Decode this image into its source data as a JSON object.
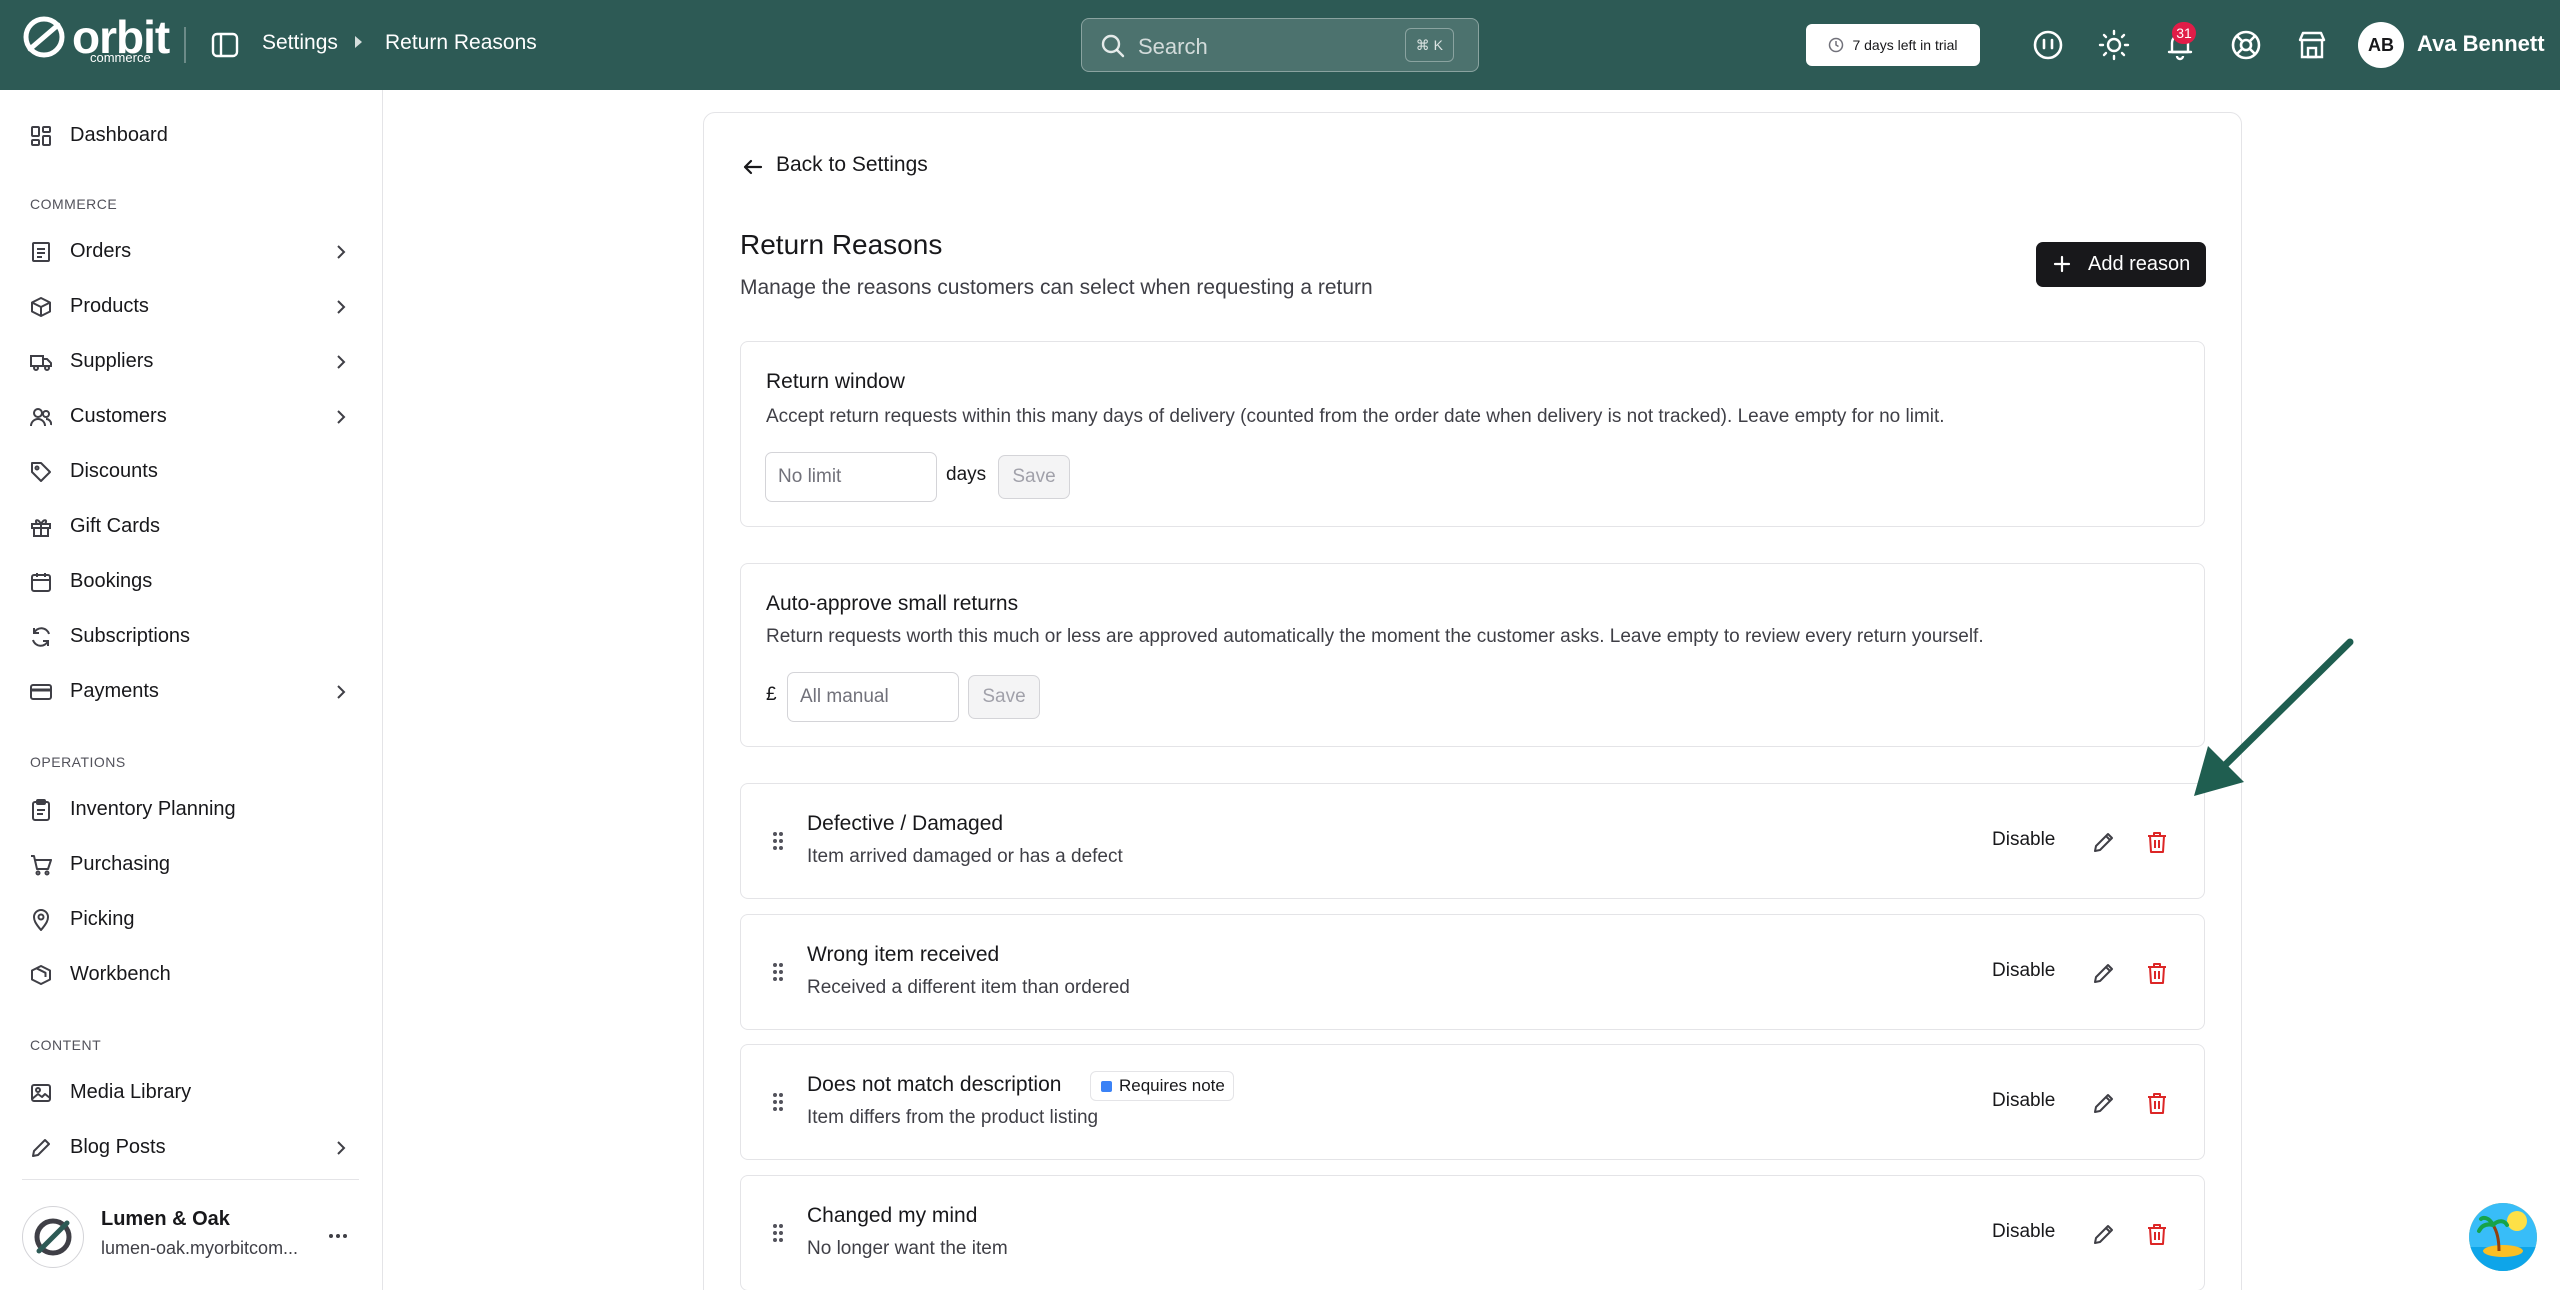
{
  "app": {
    "brand": "orbit",
    "brand_sub": "commerce",
    "colors": {
      "topbar": "#2d5a55",
      "accent": "#1f5e50",
      "danger": "#dc2626",
      "badge": "#e11d48",
      "tag_dot": "#3b82f6"
    }
  },
  "header": {
    "breadcrumb": [
      "Settings",
      "Return Reasons"
    ],
    "search": {
      "placeholder": "Search",
      "shortcut": "⌘ K"
    },
    "trial": "7 days left in trial",
    "notifications_count": "31",
    "user": {
      "initials": "AB",
      "name": "Ava Bennett"
    },
    "icons": [
      "ai-assistant-icon",
      "theme-sun-icon",
      "bell-icon",
      "help-lifebuoy-icon",
      "storefront-icon"
    ]
  },
  "sidebar": {
    "top": [
      {
        "label": "Dashboard",
        "icon": "dashboard-icon"
      }
    ],
    "sections": [
      {
        "label": "COMMERCE",
        "items": [
          {
            "label": "Orders",
            "icon": "orders-icon",
            "chevron": true
          },
          {
            "label": "Products",
            "icon": "box-icon",
            "chevron": true
          },
          {
            "label": "Suppliers",
            "icon": "truck-icon",
            "chevron": true
          },
          {
            "label": "Customers",
            "icon": "users-icon",
            "chevron": true
          },
          {
            "label": "Discounts",
            "icon": "tag-icon",
            "chevron": false
          },
          {
            "label": "Gift Cards",
            "icon": "gift-icon",
            "chevron": false
          },
          {
            "label": "Bookings",
            "icon": "calendar-icon",
            "chevron": false
          },
          {
            "label": "Subscriptions",
            "icon": "refresh-icon",
            "chevron": false
          },
          {
            "label": "Payments",
            "icon": "credit-card-icon",
            "chevron": true
          }
        ]
      },
      {
        "label": "OPERATIONS",
        "items": [
          {
            "label": "Inventory Planning",
            "icon": "clipboard-icon",
            "chevron": false
          },
          {
            "label": "Purchasing",
            "icon": "cart-icon",
            "chevron": false
          },
          {
            "label": "Picking",
            "icon": "map-pin-icon",
            "chevron": false
          },
          {
            "label": "Workbench",
            "icon": "package-icon",
            "chevron": false
          }
        ]
      },
      {
        "label": "CONTENT",
        "items": [
          {
            "label": "Media Library",
            "icon": "image-icon",
            "chevron": false
          },
          {
            "label": "Blog Posts",
            "icon": "pen-icon",
            "chevron": true
          }
        ]
      }
    ],
    "store": {
      "name": "Lumen & Oak",
      "url": "lumen-oak.myorbitcom..."
    }
  },
  "main": {
    "back_label": "Back to Settings",
    "title": "Return Reasons",
    "subtitle": "Manage the reasons customers can select when requesting a return",
    "add_button": "Add reason",
    "return_window": {
      "title": "Return window",
      "description": "Accept return requests within this many days of delivery (counted from the order date when delivery is not tracked). Leave empty for no limit.",
      "placeholder": "No limit",
      "unit": "days",
      "save": "Save"
    },
    "auto_approve": {
      "title": "Auto-approve small returns",
      "description": "Return requests worth this much or less are approved automatically the moment the customer asks. Leave empty to review every return yourself.",
      "currency": "£",
      "placeholder": "All manual",
      "save": "Save"
    },
    "reasons": [
      {
        "title": "Defective / Damaged",
        "description": "Item arrived damaged or has a defect",
        "action": "Disable"
      },
      {
        "title": "Wrong item received",
        "description": "Received a different item than ordered",
        "action": "Disable"
      },
      {
        "title": "Does not match description",
        "description": "Item differs from the product listing",
        "action": "Disable",
        "tag": "Requires note"
      },
      {
        "title": "Changed my mind",
        "description": "No longer want the item",
        "action": "Disable"
      }
    ]
  }
}
